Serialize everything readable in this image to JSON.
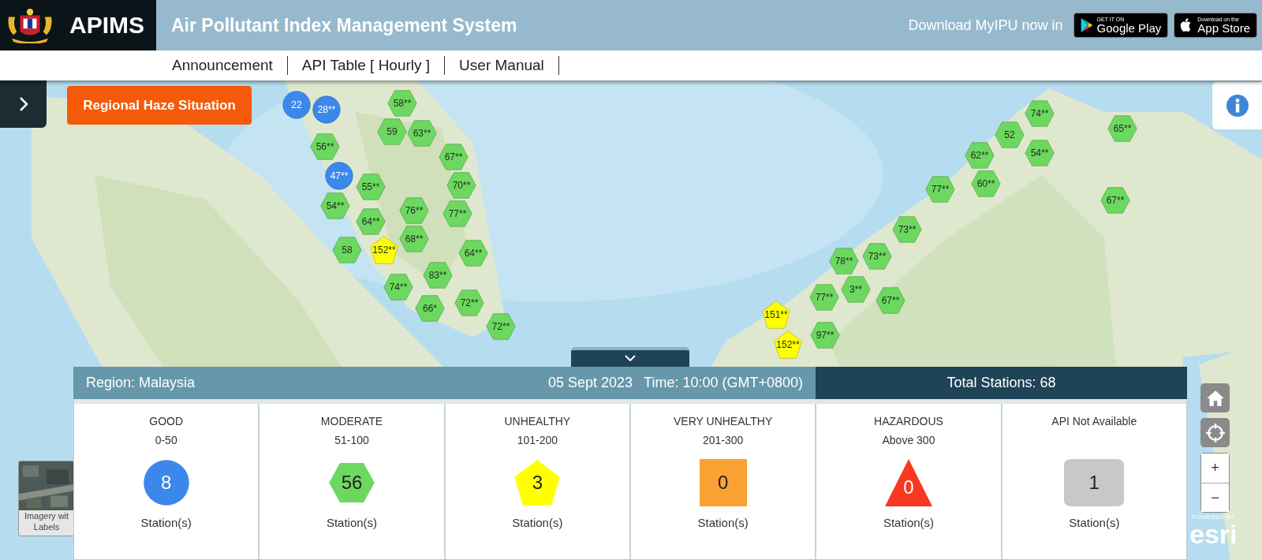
{
  "header": {
    "logo_text": "APIMS",
    "title": "Air Pollutant Index Management System",
    "download_text": "Download MyIPU now in",
    "store_badges": [
      {
        "kind": "google",
        "small": "GET IT ON",
        "large": "Google Play"
      },
      {
        "kind": "apple",
        "small": "Download on the",
        "large": "App Store"
      }
    ]
  },
  "nav": [
    "Announcement",
    "API Table [ Hourly ]",
    "User Manual"
  ],
  "map": {
    "haze_button": "Regional Haze Situation",
    "markers": [
      {
        "kind": "circle",
        "color": "#3b87ec",
        "label": "22"
      },
      {
        "kind": "circle",
        "color": "#3b87ec",
        "label": "28**"
      },
      {
        "kind": "circle",
        "color": "#3b87ec",
        "label": "47**"
      },
      {
        "kind": "hexagon",
        "color": "#6dd860",
        "label": "56**"
      },
      {
        "kind": "hexagon",
        "color": "#6dd860",
        "label": "55**"
      },
      {
        "kind": "hexagon",
        "color": "#6dd860",
        "label": "54**"
      },
      {
        "kind": "hexagon",
        "color": "#6dd860",
        "label": "59"
      },
      {
        "kind": "hexagon",
        "color": "#6dd860",
        "label": "58**"
      },
      {
        "kind": "hexagon",
        "color": "#6dd860",
        "label": "63**"
      },
      {
        "kind": "hexagon",
        "color": "#6dd860",
        "label": "67**"
      },
      {
        "kind": "hexagon",
        "color": "#6dd860",
        "label": "70**"
      },
      {
        "kind": "hexagon",
        "color": "#6dd860",
        "label": "77**"
      },
      {
        "kind": "hexagon",
        "color": "#6dd860",
        "label": "76**"
      },
      {
        "kind": "hexagon",
        "color": "#6dd860",
        "label": "68**"
      },
      {
        "kind": "hexagon",
        "color": "#6dd860",
        "label": "58"
      },
      {
        "kind": "hexagon",
        "color": "#6dd860",
        "label": "64**"
      },
      {
        "kind": "pentagon",
        "color": "#ffff00",
        "label": "152**"
      },
      {
        "kind": "hexagon",
        "color": "#6dd860",
        "label": "64**"
      },
      {
        "kind": "hexagon",
        "color": "#6dd860",
        "label": "66*"
      },
      {
        "kind": "hexagon",
        "color": "#6dd860",
        "label": "83**"
      },
      {
        "kind": "hexagon",
        "color": "#6dd860",
        "label": "74**"
      },
      {
        "kind": "hexagon",
        "color": "#6dd860",
        "label": "72**"
      },
      {
        "kind": "hexagon",
        "color": "#6dd860",
        "label": "72**"
      },
      {
        "kind": "hexagon",
        "color": "#6dd860",
        "label": "74**"
      },
      {
        "kind": "hexagon",
        "color": "#6dd860",
        "label": "65**"
      },
      {
        "kind": "hexagon",
        "color": "#6dd860",
        "label": "52"
      },
      {
        "kind": "hexagon",
        "color": "#6dd860",
        "label": "62**"
      },
      {
        "kind": "hexagon",
        "color": "#6dd860",
        "label": "54**"
      },
      {
        "kind": "hexagon",
        "color": "#6dd860",
        "label": "60**"
      },
      {
        "kind": "hexagon",
        "color": "#6dd860",
        "label": "77**"
      },
      {
        "kind": "hexagon",
        "color": "#6dd860",
        "label": "67**"
      },
      {
        "kind": "hexagon",
        "color": "#6dd860",
        "label": "73**"
      },
      {
        "kind": "hexagon",
        "color": "#6dd860",
        "label": "73**"
      },
      {
        "kind": "hexagon",
        "color": "#6dd860",
        "label": "78**"
      },
      {
        "kind": "hexagon",
        "color": "#6dd860",
        "label": "3**"
      },
      {
        "kind": "hexagon",
        "color": "#6dd860",
        "label": "77**"
      },
      {
        "kind": "hexagon",
        "color": "#6dd860",
        "label": "67**"
      },
      {
        "kind": "pentagon",
        "color": "#ffff00",
        "label": "151**"
      },
      {
        "kind": "pentagon",
        "color": "#ffff00",
        "label": "152**"
      },
      {
        "kind": "hexagon",
        "color": "#6dd860",
        "label": "97**"
      }
    ],
    "basemap": {
      "label_lines": [
        "Imagery wit",
        "Labels"
      ]
    },
    "zoom_controls": [
      "+",
      "−"
    ],
    "attribution": {
      "small": "POWERED BY",
      "large": "esri"
    }
  },
  "summary": {
    "region": "Region: Malaysia",
    "date": "05 Sept 2023",
    "time": "Time: 10:00 (GMT+0800)",
    "total": "Total Stations: 68",
    "categories": [
      {
        "label": "GOOD",
        "range": "0-50",
        "count": "8",
        "kind": "circle",
        "color": "#3b87ec",
        "unit": "Station(s)"
      },
      {
        "label": "MODERATE",
        "range": "51-100",
        "count": "56",
        "kind": "hexagon",
        "color": "#6dd860",
        "unit": "Station(s)"
      },
      {
        "label": "UNHEALTHY",
        "range": "101-200",
        "count": "3",
        "kind": "pentagon",
        "color": "#ffff00",
        "unit": "Station(s)"
      },
      {
        "label": "VERY UNHEALTHY",
        "range": "201-300",
        "count": "0",
        "kind": "square",
        "color": "#f9a233",
        "unit": "Station(s)"
      },
      {
        "label": "HAZARDOUS",
        "range": "Above 300",
        "count": "0",
        "kind": "triangle",
        "color": "#f93822",
        "unit": "Station(s)"
      },
      {
        "label": "API Not Available",
        "count": "1",
        "kind": "rounded",
        "color": "#c8c8c8",
        "unit": "Station(s)"
      }
    ]
  }
}
